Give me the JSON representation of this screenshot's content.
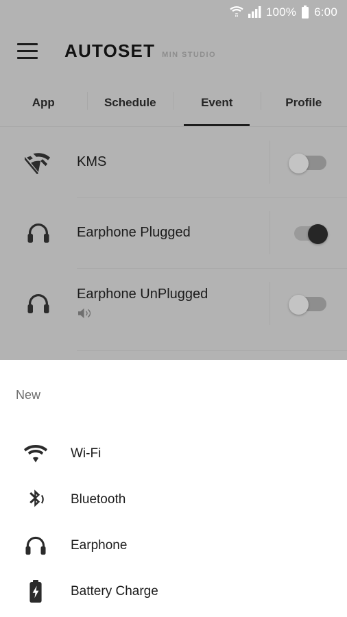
{
  "status_bar": {
    "wifi_icon": "wifi-data-icon",
    "signal_icon": "cellular-signal-icon",
    "battery_percent": "100%",
    "battery_icon": "battery-full-icon",
    "time": "6:00"
  },
  "app_bar": {
    "menu_icon": "hamburger-menu-icon",
    "title": "AUTOSET",
    "subtitle": "MIN STUDIO"
  },
  "tabs": [
    {
      "label": "App",
      "active": false
    },
    {
      "label": "Schedule",
      "active": false
    },
    {
      "label": "Event",
      "active": true
    },
    {
      "label": "Profile",
      "active": false
    }
  ],
  "event_list": [
    {
      "icon": "wifi-off-icon",
      "label": "KMS",
      "sub_icon": null,
      "toggle_state": "off"
    },
    {
      "icon": "headphone-icon",
      "label": "Earphone Plugged",
      "sub_icon": null,
      "toggle_state": "on"
    },
    {
      "icon": "headphone-icon",
      "label": "Earphone UnPlugged",
      "sub_icon": "volume-icon",
      "toggle_state": "off"
    }
  ],
  "bottom_sheet": {
    "title": "New",
    "items": [
      {
        "icon": "wifi-icon",
        "label": "Wi-Fi"
      },
      {
        "icon": "bluetooth-audio-icon",
        "label": "Bluetooth"
      },
      {
        "icon": "headphone-icon",
        "label": "Earphone"
      },
      {
        "icon": "battery-charging-icon",
        "label": "Battery Charge"
      }
    ]
  },
  "colors": {
    "scrim": "#b3b3b3",
    "sheet_background": "#ffffff",
    "text_primary": "#1b1b1b",
    "text_muted": "#6d6d6d",
    "toggle_on_thumb": "#262626",
    "toggle_off_thumb": "#c4c4c4",
    "divider": "#aaaaaa",
    "status_bar_text": "#ffffff"
  }
}
